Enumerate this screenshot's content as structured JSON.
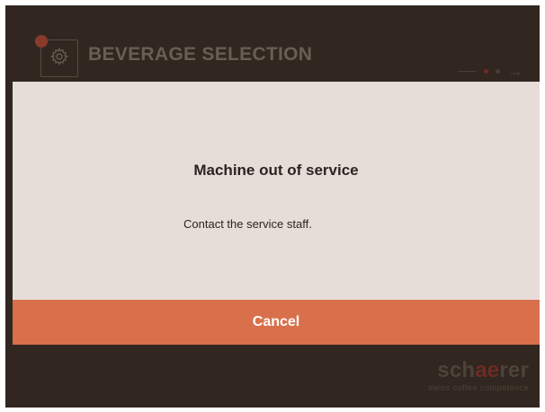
{
  "header": {
    "title": "BEVERAGE SELECTION",
    "settings_icon": "gear-icon",
    "alert_icon": "alert-dot-icon",
    "next_icon": "arrow-right-icon"
  },
  "dialog": {
    "title": "Machine out of service",
    "message": "Contact the service staff.",
    "cancel_label": "Cancel"
  },
  "brand": {
    "wordmark_part1": "sch",
    "wordmark_part2": "ae",
    "wordmark_part3": "rer",
    "tagline": "swiss coffee competence"
  },
  "colors": {
    "background": "#312720",
    "dialog": "#e6ddd8",
    "cancel": "#d9704c",
    "accent": "#6e2b22"
  }
}
